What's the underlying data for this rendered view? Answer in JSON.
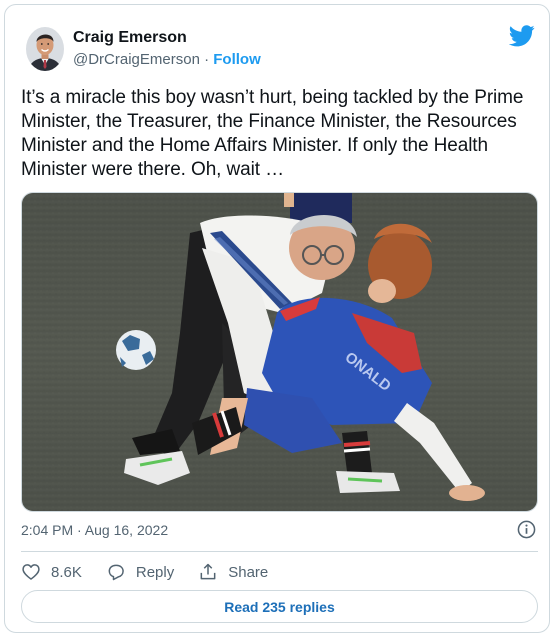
{
  "author": {
    "name": "Craig Emerson",
    "handle": "@DrCraigEmerson",
    "separator": "·",
    "follow_label": "Follow"
  },
  "tweet": {
    "text": "It’s a miracle this boy wasn’t hurt, being tackled by the Prime Minister, the Treasurer, the Finance Minister, the Resources Minister and the Home Affairs Minister. If only the Health Minister were there. Oh, wait …",
    "timestamp": "2:04 PM · Aug 16, 2022"
  },
  "media": {
    "jersey_text": "ONALD"
  },
  "actions": {
    "likes": "8.6K",
    "reply_label": "Reply",
    "share_label": "Share"
  },
  "replies_button": "Read 235 replies",
  "icons": {
    "logo": "twitter-bird-icon",
    "info": "info-icon",
    "like": "heart-icon",
    "reply": "reply-bubble-icon",
    "share": "share-upload-icon"
  },
  "colors": {
    "accent": "#1d9bf0",
    "link_dark": "#1d6fb8",
    "text": "#0f1419",
    "secondary": "#536471",
    "border": "#cfd9de"
  }
}
